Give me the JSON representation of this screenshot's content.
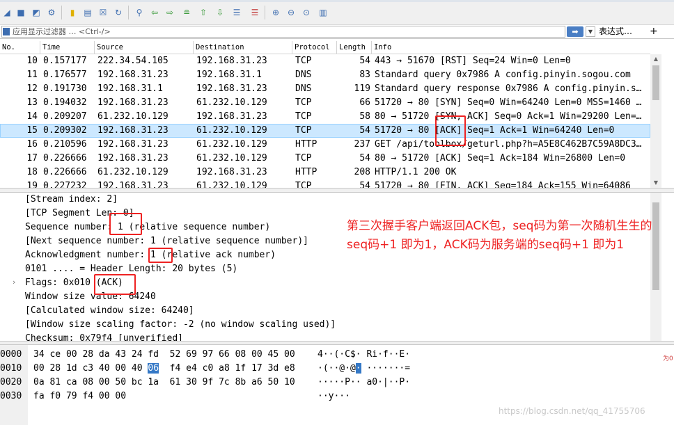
{
  "toolbar": {
    "icons": [
      "shark-fin-icon",
      "stop-icon",
      "restart-icon",
      "options-gear-icon",
      "open-file-icon",
      "save-file-icon",
      "close-file-icon",
      "reload-icon",
      "find-icon",
      "go-back-icon",
      "go-forward-icon",
      "go-to-packet-icon",
      "go-first-icon",
      "go-last-icon",
      "autoscroll-icon",
      "colorize-icon",
      "zoom-in-icon",
      "zoom-out-icon",
      "zoom-normal-icon",
      "resize-columns-icon"
    ]
  },
  "filter": {
    "placeholder": "应用显示过滤器 … <Ctrl-/>",
    "apply_label": "➡",
    "dropdown_label": "▼",
    "expression_label": "表达式…",
    "add_label": "+"
  },
  "packet_list": {
    "columns": [
      "No.",
      "Time",
      "Source",
      "Destination",
      "Protocol",
      "Length",
      "Info"
    ],
    "rows": [
      {
        "no": "10",
        "time": "0.157177",
        "src": "222.34.54.105",
        "dst": "192.168.31.23",
        "proto": "TCP",
        "len": "54",
        "info": "443 → 51670 [RST] Seq=24 Win=0 Len=0"
      },
      {
        "no": "11",
        "time": "0.176577",
        "src": "192.168.31.23",
        "dst": "192.168.31.1",
        "proto": "DNS",
        "len": "83",
        "info": "Standard query 0x7986 A config.pinyin.sogou.com"
      },
      {
        "no": "12",
        "time": "0.191730",
        "src": "192.168.31.1",
        "dst": "192.168.31.23",
        "proto": "DNS",
        "len": "119",
        "info": "Standard query response 0x7986 A config.pinyin.s…"
      },
      {
        "no": "13",
        "time": "0.194032",
        "src": "192.168.31.23",
        "dst": "61.232.10.129",
        "proto": "TCP",
        "len": "66",
        "info": "51720 → 80 [SYN] Seq=0 Win=64240 Len=0 MSS=1460 …"
      },
      {
        "no": "14",
        "time": "0.209207",
        "src": "61.232.10.129",
        "dst": "192.168.31.23",
        "proto": "TCP",
        "len": "58",
        "info": "80 → 51720 [SYN, ACK] Seq=0 Ack=1 Win=29200 Len=…"
      },
      {
        "no": "15",
        "time": "0.209302",
        "src": "192.168.31.23",
        "dst": "61.232.10.129",
        "proto": "TCP",
        "len": "54",
        "info": "51720 → 80 [ACK] Seq=1 Ack=1 Win=64240 Len=0",
        "selected": true
      },
      {
        "no": "16",
        "time": "0.210596",
        "src": "192.168.31.23",
        "dst": "61.232.10.129",
        "proto": "HTTP",
        "len": "237",
        "info": "GET /api/toolbox/geturl.php?h=A5E8C462B7C59A8DC3…"
      },
      {
        "no": "17",
        "time": "0.226666",
        "src": "192.168.31.23",
        "dst": "61.232.10.129",
        "proto": "TCP",
        "len": "54",
        "info": "80 → 51720 [ACK] Seq=1 Ack=184 Win=26800 Len=0"
      },
      {
        "no": "18",
        "time": "0.226666",
        "src": "61.232.10.129",
        "dst": "192.168.31.23",
        "proto": "HTTP",
        "len": "208",
        "info": "HTTP/1.1 200 OK"
      },
      {
        "no": "19",
        "time": "0.227232",
        "src": "192.168.31.23",
        "dst": "61.232.10.129",
        "proto": "TCP",
        "len": "54",
        "info": "51720 → 80 [FIN, ACK] Seq=184 Ack=155 Win=64086"
      }
    ]
  },
  "details": {
    "lines": [
      "[Stream index: 2]",
      "[TCP Segment Len: 0]",
      "Sequence number: 1    (relative sequence number)",
      "[Next sequence number: 1    (relative sequence number)]",
      "Acknowledgment number: 1    (relative ack number)",
      "0101 .... = Header Length: 20 bytes (5)",
      "Flags: 0x010 (ACK)",
      "Window size value: 64240",
      "[Calculated window size: 64240]",
      "[Window size scaling factor: -2 (no window scaling used)]",
      "Checksum: 0x79f4 [unverified]"
    ],
    "expander": "›"
  },
  "bytes": {
    "rows": [
      {
        "offset": "0000",
        "pre": "34 ce 00 28 da 43 24 fd  52 69 97 66 08 00 45 00",
        "hl": "",
        "post": "",
        "ascii_pre": "4··(·C$· Ri·f··E·",
        "ascii_hl": "",
        "ascii_post": ""
      },
      {
        "offset": "0010",
        "pre": "00 28 1d c3 40 00 40 ",
        "hl": "06",
        "post": "  f4 e4 c0 a8 1f 17 3d e8",
        "ascii_pre": "·(··@·@",
        "ascii_hl": "·",
        "ascii_post": " ·······="
      },
      {
        "offset": "0020",
        "pre": "0a 81 ca 08 00 50 bc 1a  61 30 9f 7c 8b a6 50 10",
        "hl": "",
        "post": "",
        "ascii_pre": "·····P·· a0·|··P·",
        "ascii_hl": "",
        "ascii_post": ""
      },
      {
        "offset": "0030",
        "pre": "fa f0 79 f4 00 00",
        "hl": "",
        "post": "",
        "ascii_pre": "··y···",
        "ascii_hl": "",
        "ascii_post": ""
      }
    ]
  },
  "annotation": {
    "text": "第三次握手客户端返回ACK包，seq码为第一次随机生生的seq码+1 即为1，ACK码为服务端的seq码+1 即为1"
  },
  "watermark": "https://blog.csdn.net/qq_41755706",
  "side_mark": "为0"
}
